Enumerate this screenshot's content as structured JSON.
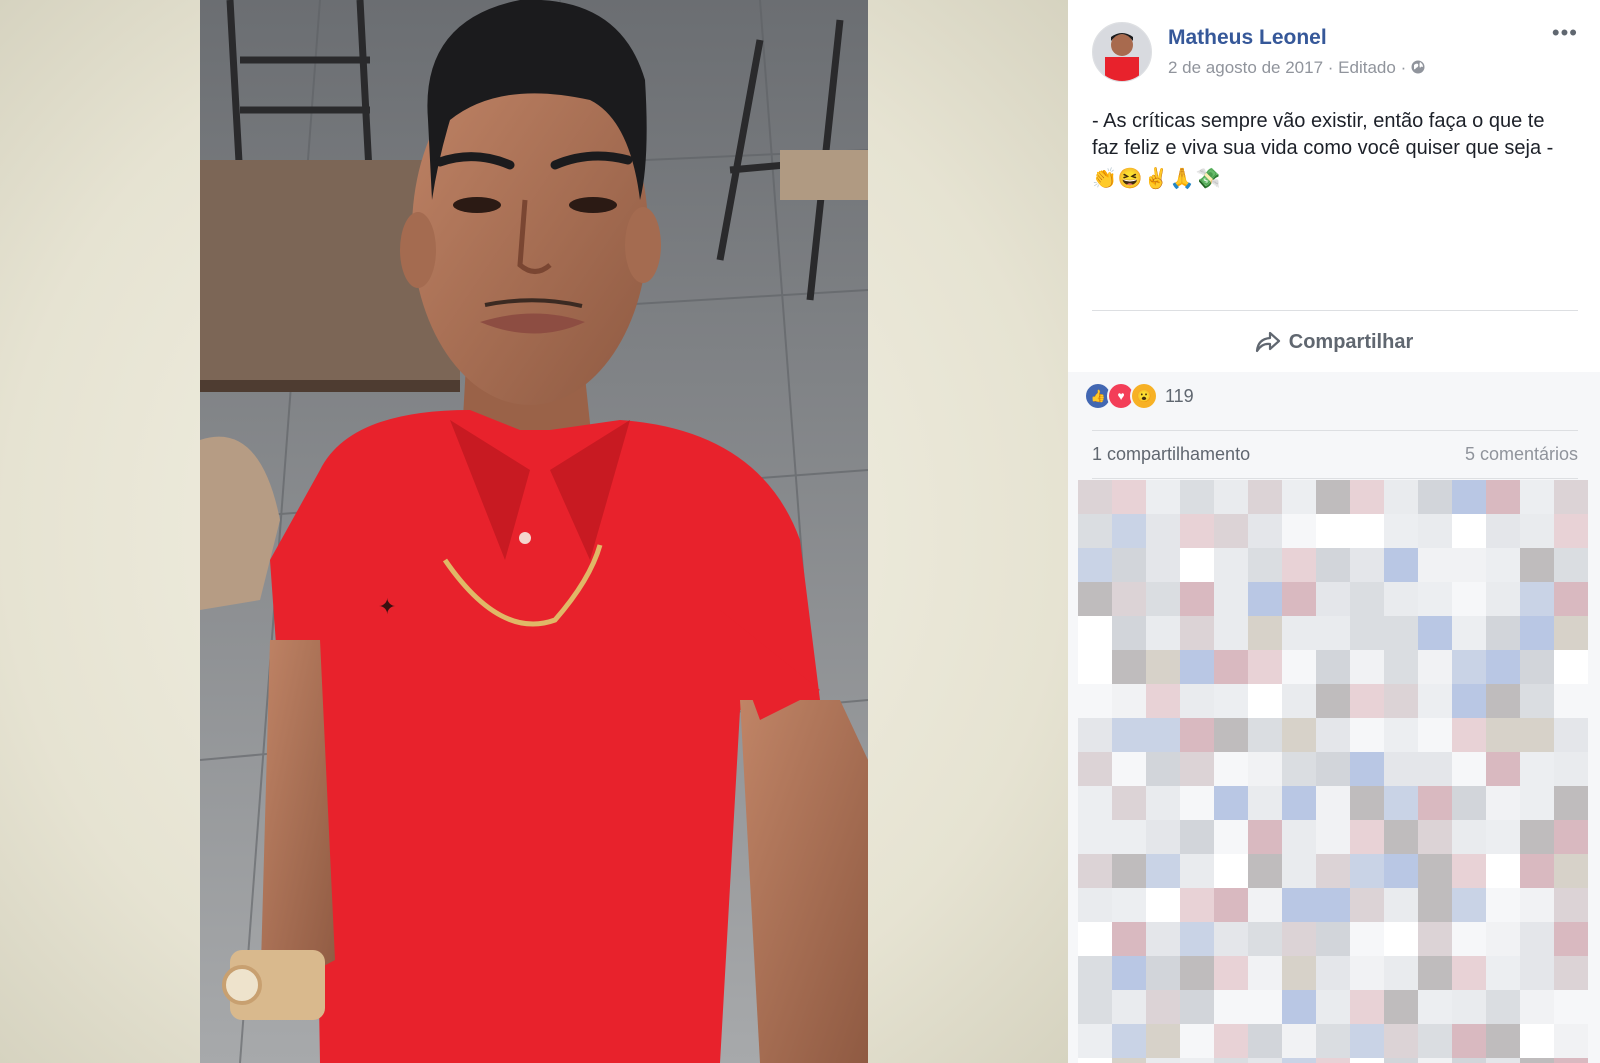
{
  "post": {
    "author": "Matheus Leonel",
    "date": "2 de agosto de 2017",
    "edited": "Editado",
    "separator": "·",
    "privacy_icon": "globe-icon",
    "more_icon": "ellipsis-icon",
    "caption": "- As críticas sempre vão existir, então faça o que te faz feliz e viva sua vida como você quiser que seja -",
    "emojis": "👏😆✌🙏💸"
  },
  "actions": {
    "share_label": "Compartilhar",
    "share_icon": "share-arrow-icon"
  },
  "reactions": {
    "icons": [
      "like-icon",
      "love-icon",
      "wow-icon"
    ],
    "count": "119"
  },
  "stats": {
    "shares": "1 compartilhamento",
    "comments": "5 comentários"
  },
  "colors": {
    "link": "#365899",
    "muted": "#90949c",
    "like": "#4267b2",
    "love": "#f33e58",
    "wow": "#f7b125",
    "shirt": "#e8222c"
  }
}
